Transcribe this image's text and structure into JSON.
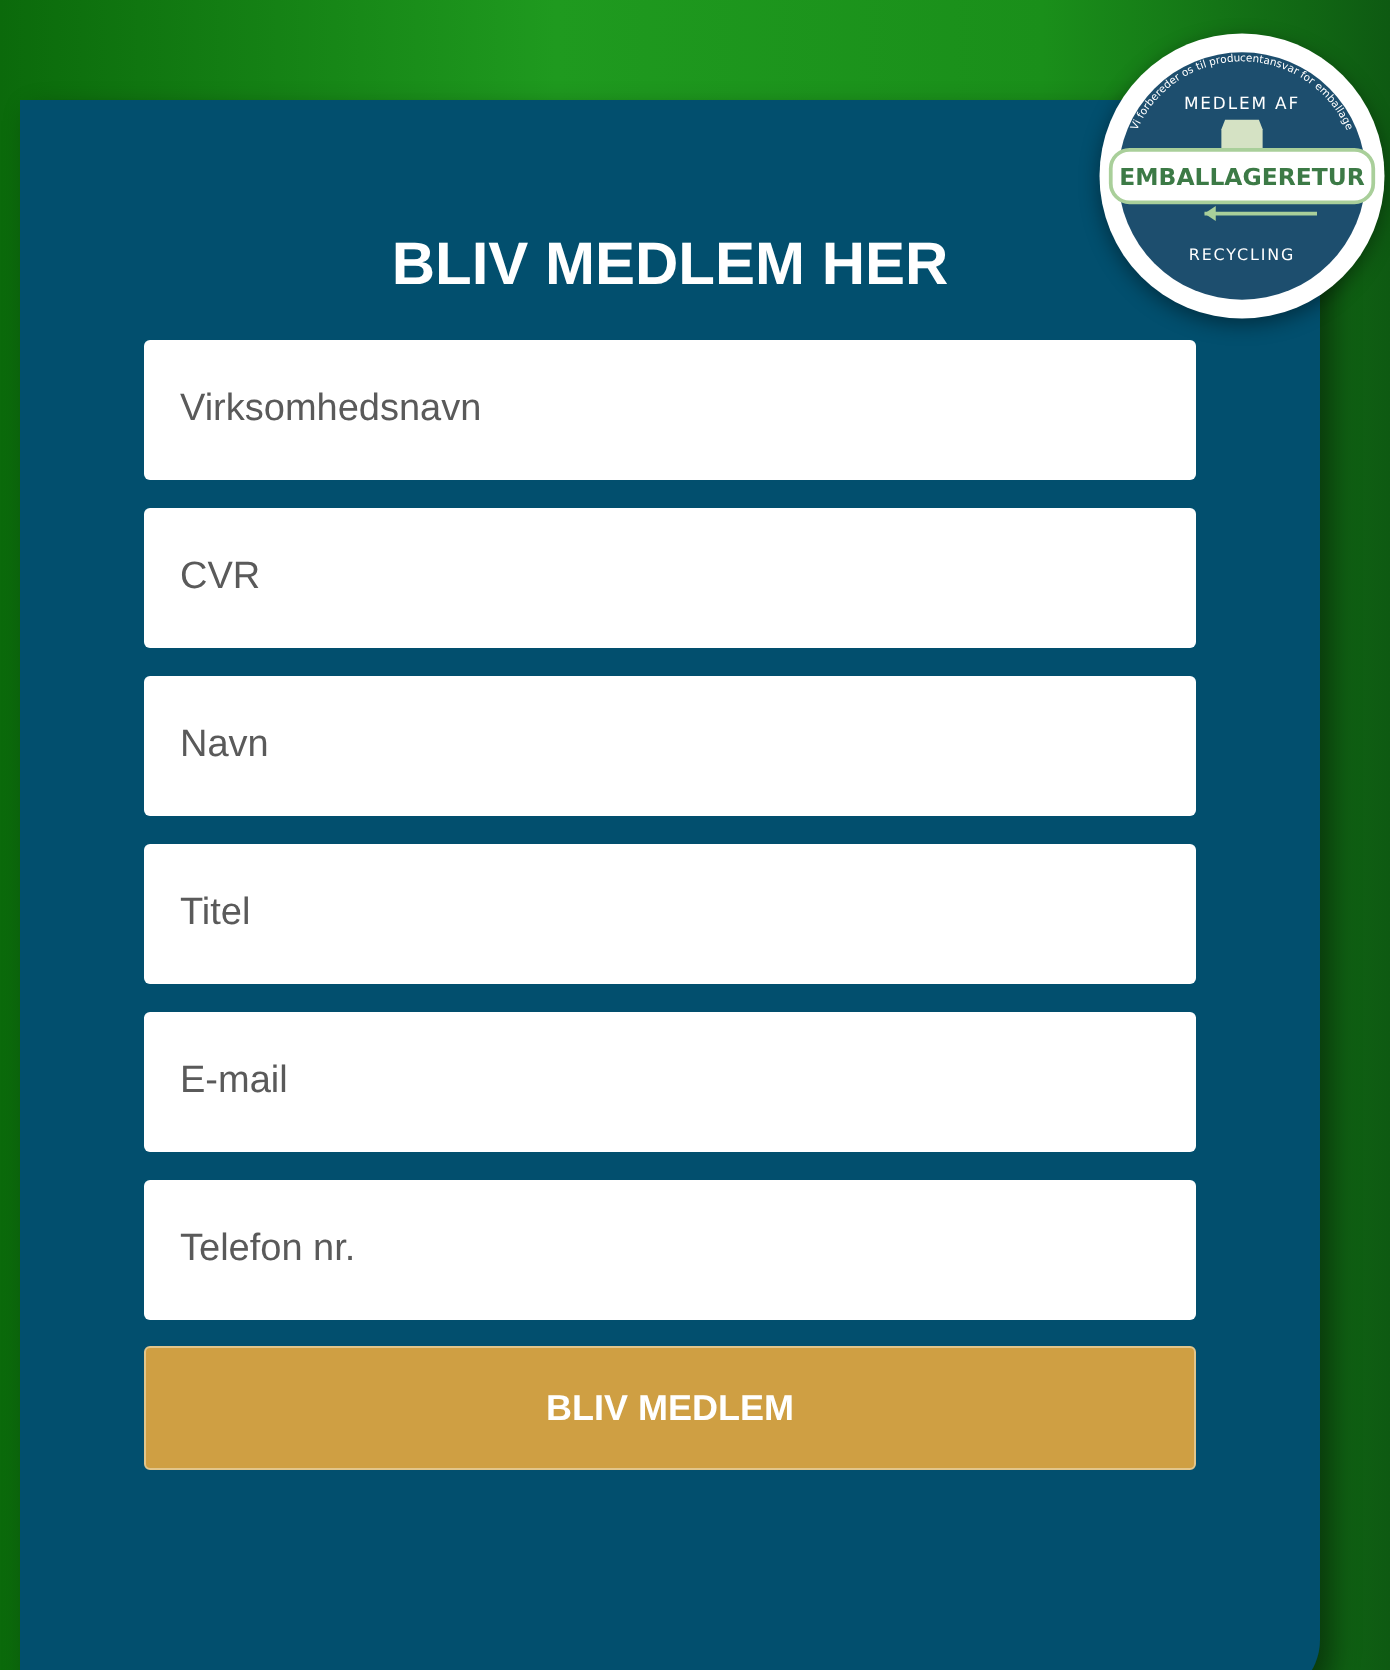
{
  "form": {
    "title": "BLIV MEDLEM HER",
    "fields": [
      {
        "placeholder": "Virksomhedsnavn"
      },
      {
        "placeholder": "CVR"
      },
      {
        "placeholder": "Navn"
      },
      {
        "placeholder": "Titel"
      },
      {
        "placeholder": "E-mail"
      },
      {
        "placeholder": "Telefon nr."
      }
    ],
    "submit": "BLIV MEDLEM"
  },
  "badge": {
    "ring_text": "Vi forbereder os til producentansvar for emballage",
    "top": "MEDLEM AF",
    "name": "EMBALLAGERETUR",
    "bottom": "RECYCLING"
  }
}
